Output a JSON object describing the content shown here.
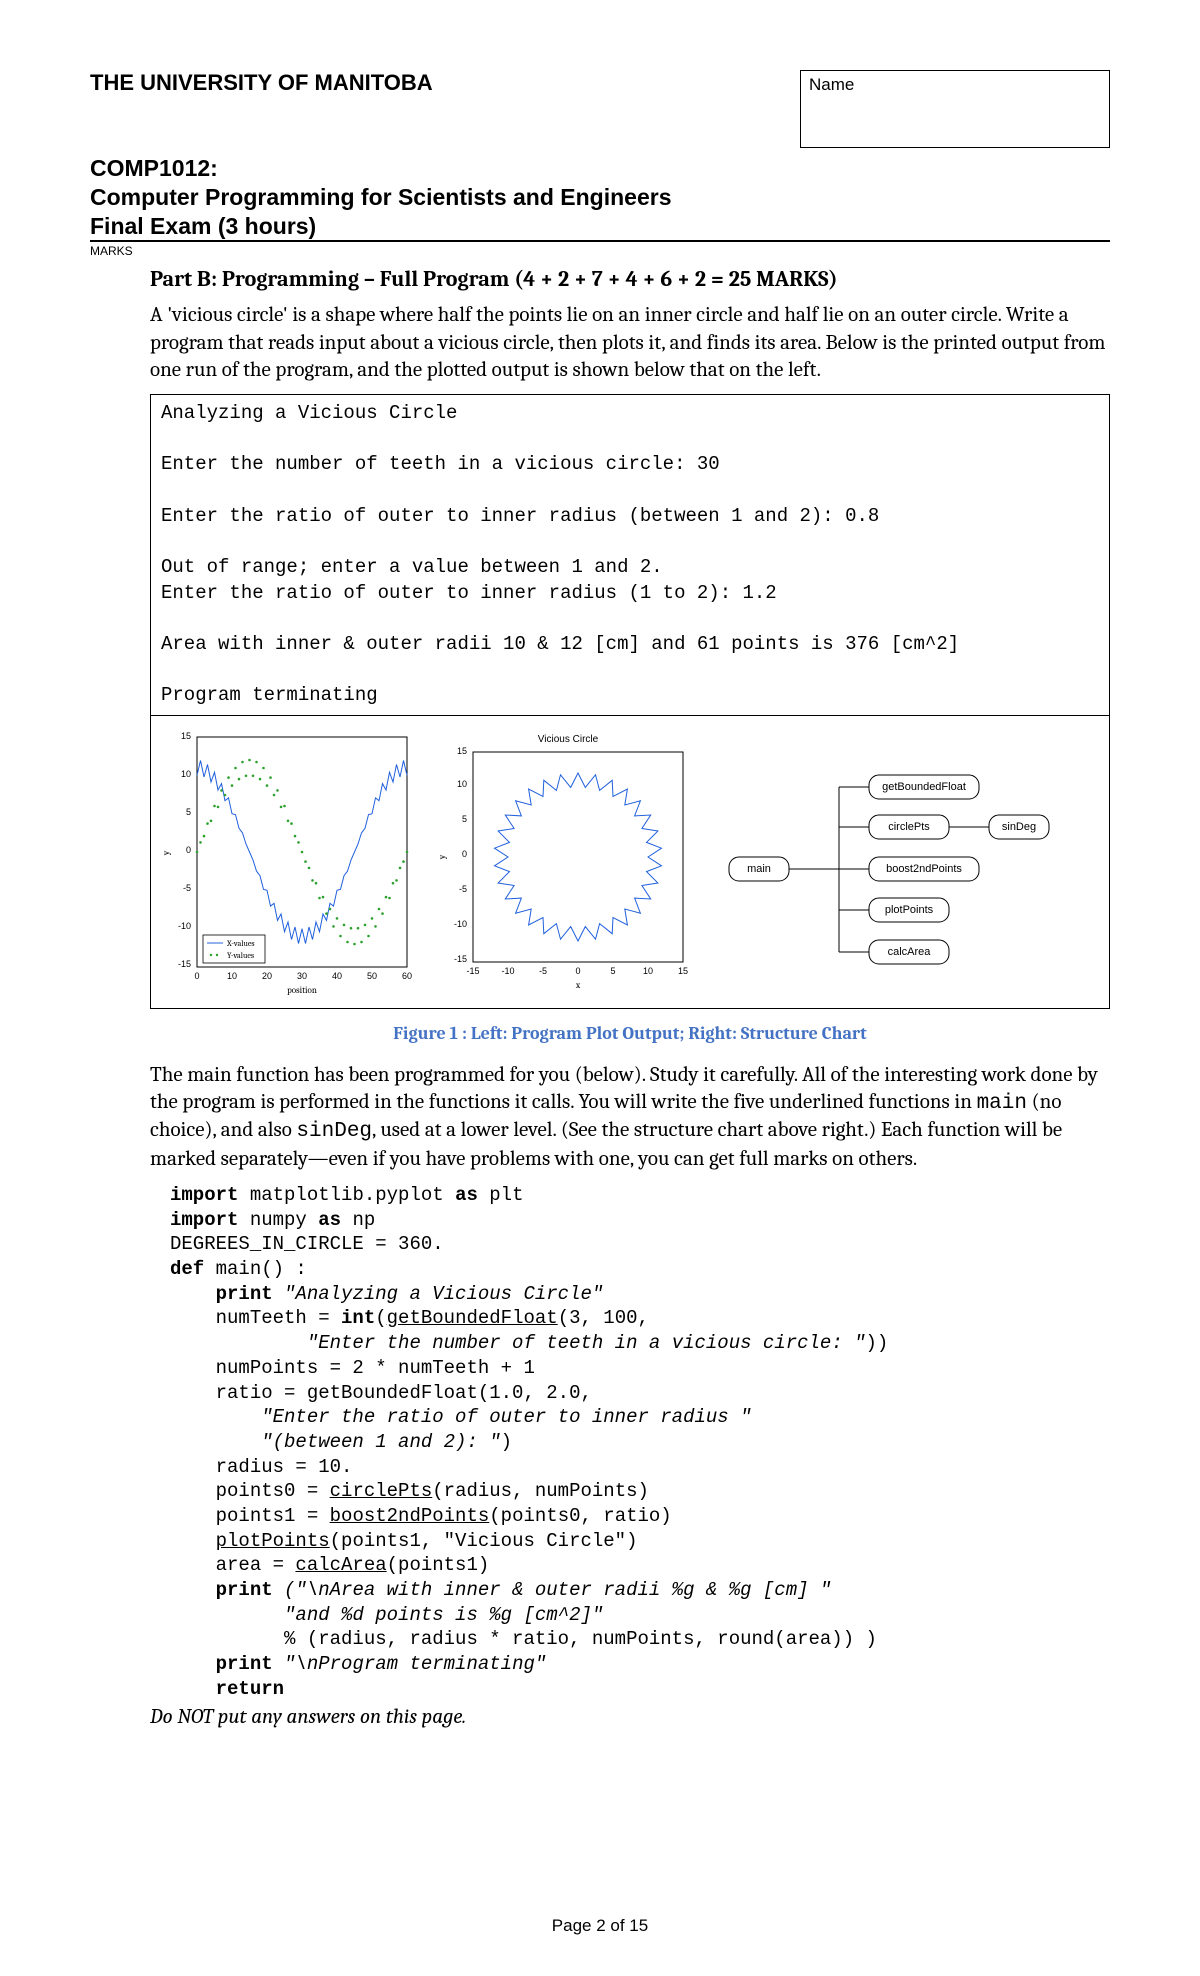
{
  "header": {
    "university": "THE UNIVERSITY OF MANITOBA",
    "name_label": "Name",
    "course_code": "COMP1012:",
    "course_title": "Computer Programming for Scientists and Engineers",
    "exam_line": "Final Exam (3 hours)",
    "marks_label": "MARKS"
  },
  "part_b": {
    "title": "Part B: Programming – Full Program (4 + 2 + 7 + 4 + 6 + 2 = 25 MARKS)",
    "intro": "A 'vicious circle' is a shape where half the points lie on an inner circle and half lie on an outer circle. Write a program that reads input about a vicious circle, then plots it, and finds its area. Below is the printed output from one run of the program, and the plotted output is shown below that on the left.",
    "console_output": "Analyzing a Vicious Circle\n\nEnter the number of teeth in a vicious circle: 30\n\nEnter the ratio of outer to inner radius (between 1 and 2): 0.8\n\nOut of range; enter a value between 1 and 2.\nEnter the ratio of outer to inner radius (1 to 2): 1.2\n\nArea with inner & outer radii 10 & 12 [cm] and 61 points is 376 [cm^2]\n\nProgram terminating",
    "figure_caption": "Figure 1 : Left: Program Plot Output; Right: Structure Chart",
    "body2": "The main function has been programmed for you (below). Study it carefully. All of the interesting work done by the program is performed in the functions it calls. You will write the five underlined functions in ",
    "body2_code": "main",
    "body2b": " (no choice), and also ",
    "body2_code2": "sinDeg",
    "body2c": ", used at a lower level. (See the structure chart above right.) Each function will be marked separately—even if you have problems with one, you can get full marks on others.",
    "footer_note": "Do NOT put any answers on this page."
  },
  "charts": {
    "left_plot": {
      "xlabel": "position",
      "ylabel": "y",
      "xlim": [
        0,
        60
      ],
      "ylim": [
        -15,
        15
      ],
      "xticks": [
        0,
        10,
        20,
        30,
        40,
        50,
        60
      ],
      "yticks": [
        -15,
        -10,
        -5,
        0,
        5,
        10,
        15
      ],
      "legend": [
        "X-values",
        "Y-values"
      ]
    },
    "center_plot": {
      "title": "Vicious Circle",
      "xlabel": "x",
      "ylabel": "y",
      "xlim": [
        -15,
        15
      ],
      "ylim": [
        -15,
        15
      ],
      "xticks": [
        -15,
        -10,
        -5,
        0,
        5,
        10,
        15
      ],
      "yticks": [
        -15,
        -10,
        -5,
        0,
        5,
        10,
        15
      ]
    },
    "structure": {
      "root": "main",
      "children": [
        "getBoundedFloat",
        "circlePts",
        "boost2ndPoints",
        "plotPoints",
        "calcArea"
      ],
      "grandchild": "sinDeg"
    }
  },
  "code": {
    "l1": "import",
    "l1b": " matplotlib.pyplot ",
    "l1c": "as",
    "l1d": " plt",
    "l2": "import",
    "l2b": " numpy ",
    "l2c": "as",
    "l2d": " np",
    "l3": "DEGREES_IN_CIRCLE = 360.",
    "l4": "def",
    "l4b": " main() :",
    "l5a": "    ",
    "l5": "print",
    "l5b": " ",
    "l5c": "\"Analyzing a Vicious Circle\"",
    "l6": "    numTeeth = ",
    "l6b": "int",
    "l6c": "(",
    "l6d": "getBoundedFloat",
    "l6e": "(3, 100,",
    "l7a": "            ",
    "l7": "\"Enter the number of teeth in a vicious circle: \"",
    "l7b": "))",
    "l8": "    numPoints = 2 * numTeeth + 1",
    "l9": "    ratio = getBoundedFloat(1.0, 2.0,",
    "l10a": "        ",
    "l10": "\"Enter the ratio of outer to inner radius \"",
    "l11a": "        ",
    "l11": "\"(between 1 and 2): \"",
    "l11b": ")",
    "l12": "    radius = 10.",
    "l13": "    points0 = ",
    "l13b": "circlePts",
    "l13c": "(radius, numPoints)",
    "l14": "    points1 = ",
    "l14b": "boost2ndPoints",
    "l14c": "(points0, ratio)",
    "l15": "    ",
    "l15b": "plotPoints",
    "l15c": "(points1, \"Vicious Circle\")",
    "l16": "    area = ",
    "l16b": "calcArea",
    "l16c": "(points1)",
    "l17a": "    ",
    "l17": "print",
    "l17b": " ",
    "l17c": "(\"\\nArea with inner & outer radii %g & %g [cm] \"",
    "l18a": "          ",
    "l18": "\"and %d points is %g [cm^2]\"",
    "l19": "          % (radius, radius * ratio, numPoints, round(area)) )",
    "l20a": "    ",
    "l20": "print",
    "l20b": " ",
    "l20c": "\"\\nProgram terminating\"",
    "l21a": "    ",
    "l21": "return"
  },
  "page_number": "Page 2 of 15"
}
